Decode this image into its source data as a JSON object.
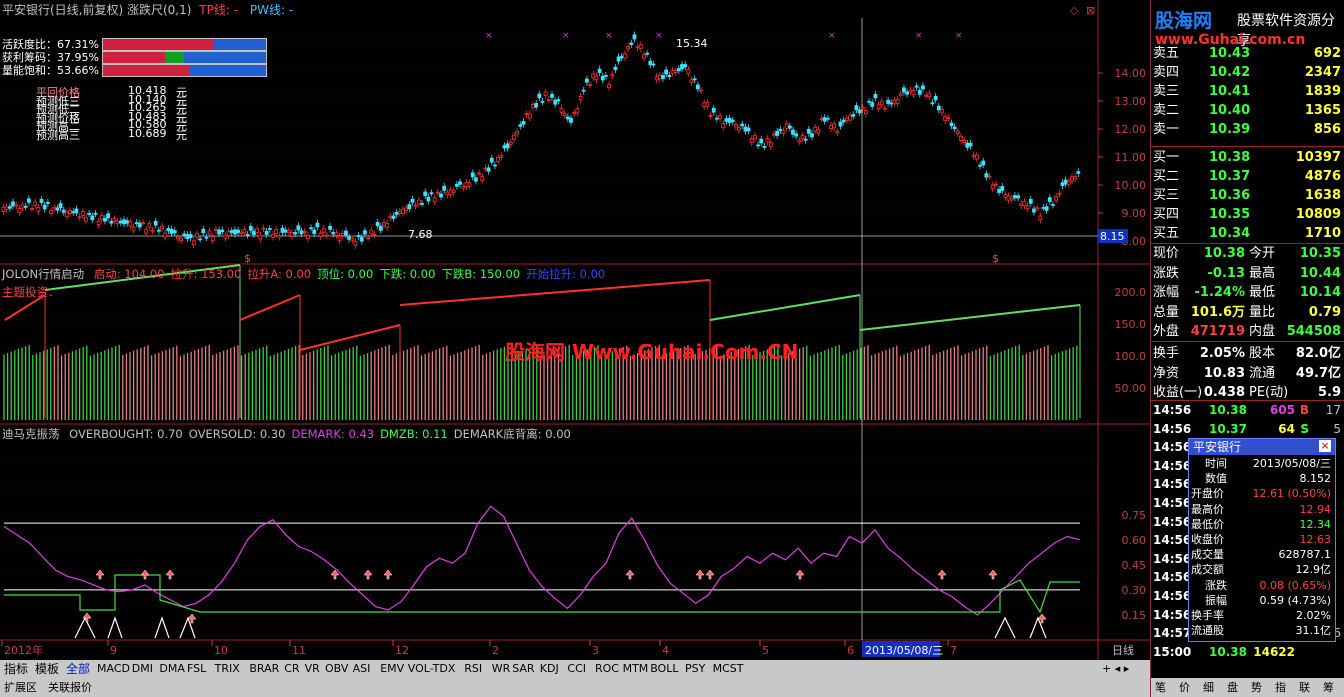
{
  "header": {
    "title": "平安银行(日线,前复权) 涨跌尺(0,1)",
    "tp_label": "TP线: -",
    "pw_label": "PW线: -"
  },
  "watermark_logo": "股海网",
  "watermark_sub": "股票软件资源分享",
  "watermark_url": "www.Guhai.com.cn",
  "watermark_center": "股海网 Www.Guhai.Com.CN",
  "gauges": [
    {
      "label": "活跃度比：67.31%",
      "red": 0.6731,
      "green": 0
    },
    {
      "label": "获利筹码：37.95%",
      "red": 0.38,
      "green": 0.12
    },
    {
      "label": "量能饱和：53.66%",
      "red": 0.5366,
      "green": 0
    }
  ],
  "predictions": [
    {
      "label": "平回价格",
      "value": "10.418",
      "unit": "元"
    },
    {
      "label": "预测低三",
      "value": "10.140",
      "unit": "元"
    },
    {
      "label": "预测低二",
      "value": "10.265",
      "unit": "元"
    },
    {
      "label": "预测价格",
      "value": "10.483",
      "unit": "元"
    },
    {
      "label": "预测高二",
      "value": "10.580",
      "unit": "元"
    },
    {
      "label": "预测高三",
      "value": "10.689",
      "unit": "元"
    }
  ],
  "price_axis": [
    "14.00",
    "13.00",
    "12.00",
    "11.00",
    "10.00",
    "9.00",
    "8.00"
  ],
  "price_marks": {
    "high": "15.34",
    "low": "7.68",
    "cursor": "8.15"
  },
  "indicator1": {
    "name": "JOLON行情启动",
    "params": [
      {
        "label": "启动: 104.00",
        "color": "#ff4040"
      },
      {
        "label": "拉升: 153.00",
        "color": "#ff4040"
      },
      {
        "label": "拉升A: 0.00",
        "color": "#ff4040"
      },
      {
        "label": "顶位: 0.00",
        "color": "#40ff40"
      },
      {
        "label": "下跌: 0.00",
        "color": "#40ff40"
      },
      {
        "label": "下跌B: 150.00",
        "color": "#40ff40"
      },
      {
        "label": "开始拉升: 0.00",
        "color": "#4040ff"
      }
    ],
    "subtitle": "主题投资：",
    "axis": [
      "200.0",
      "150.0",
      "100.0",
      "50.00"
    ]
  },
  "indicator2": {
    "name": "迪马克振荡",
    "params": [
      {
        "label": "OVERBOUGHT: 0.70",
        "color": "#c0c0c0"
      },
      {
        "label": "OVERSOLD: 0.30",
        "color": "#c0c0c0"
      },
      {
        "label": "DEMARK: 0.43",
        "color": "#e040e0"
      },
      {
        "label": "DMZB: 0.11",
        "color": "#40ff40"
      },
      {
        "label": "DEMARK底背离: 0.00",
        "color": "#c0c0c0"
      }
    ],
    "axis": [
      "0.75",
      "0.60",
      "0.45",
      "0.30",
      "0.15"
    ]
  },
  "date_axis": [
    "2012年",
    "9",
    "10",
    "11",
    "12",
    "2",
    "3",
    "4",
    "5",
    "6",
    "7"
  ],
  "date_cursor": "2013/05/08/三",
  "period_label": "日线",
  "tabs": [
    "指标",
    "模板",
    "全部",
    "MACD",
    "DMI",
    "DMA",
    "FSL",
    "TRIX",
    "BRAR",
    "CR",
    "VR",
    "OBV",
    "ASI",
    "EMV",
    "VOL-TDX",
    "RSI",
    "WR",
    "SAR",
    "KDJ",
    "CCI",
    "ROC",
    "MTM",
    "BOLL",
    "PSY",
    "MCST"
  ],
  "bottom_tabs": [
    "扩展区",
    "关联报价"
  ],
  "orderbook": {
    "asks": [
      {
        "label": "卖五",
        "price": "10.43",
        "vol": "692"
      },
      {
        "label": "卖四",
        "price": "10.42",
        "vol": "2347"
      },
      {
        "label": "卖三",
        "price": "10.41",
        "vol": "1839"
      },
      {
        "label": "卖二",
        "price": "10.40",
        "vol": "1365"
      },
      {
        "label": "卖一",
        "price": "10.39",
        "vol": "856"
      }
    ],
    "bids": [
      {
        "label": "买一",
        "price": "10.38",
        "vol": "10397"
      },
      {
        "label": "买二",
        "price": "10.37",
        "vol": "4876"
      },
      {
        "label": "买三",
        "price": "10.36",
        "vol": "1638"
      },
      {
        "label": "买四",
        "price": "10.35",
        "vol": "10809"
      },
      {
        "label": "买五",
        "price": "10.34",
        "vol": "1710"
      }
    ]
  },
  "quote": [
    {
      "l1": "现价",
      "v1": "10.38",
      "c1": "#40ff40",
      "l2": "今开",
      "v2": "10.35",
      "c2": "#40ff40"
    },
    {
      "l1": "涨跌",
      "v1": "-0.13",
      "c1": "#40ff40",
      "l2": "最高",
      "v2": "10.44",
      "c2": "#40ff40"
    },
    {
      "l1": "涨幅",
      "v1": "-1.24%",
      "c1": "#40ff40",
      "l2": "最低",
      "v2": "10.14",
      "c2": "#40ff40"
    },
    {
      "l1": "总量",
      "v1": "101.6万",
      "c1": "#ffff40",
      "l2": "量比",
      "v2": "0.79",
      "c2": "#ffff40"
    },
    {
      "l1": "外盘",
      "v1": "471719",
      "c1": "#ff4040",
      "l2": "内盘",
      "v2": "544508",
      "c2": "#40ff40"
    },
    {
      "l1": "换手",
      "v1": "2.05%",
      "c1": "#ffffff",
      "l2": "股本",
      "v2": "82.0亿",
      "c2": "#ffffff"
    },
    {
      "l1": "净资",
      "v1": "10.83",
      "c1": "#ffffff",
      "l2": "流通",
      "v2": "49.7亿",
      "c2": "#ffffff"
    },
    {
      "l1": "收益(一)",
      "v1": "0.438",
      "c1": "#ffffff",
      "l2": "PE(动)",
      "v2": "5.9",
      "c2": "#ffffff"
    }
  ],
  "ticks": [
    {
      "t": "14:56",
      "p": "10.38",
      "v": "605",
      "d": "B",
      "n": "17"
    },
    {
      "t": "14:56",
      "p": "10.37",
      "v": "64",
      "d": "S",
      "n": "5"
    },
    {
      "t": "14:56",
      "p": "",
      "v": "",
      "d": "",
      "n": ""
    },
    {
      "t": "14:56",
      "p": "",
      "v": "",
      "d": "",
      "n": ""
    },
    {
      "t": "14:56",
      "p": "",
      "v": "",
      "d": "",
      "n": ""
    },
    {
      "t": "14:56",
      "p": "",
      "v": "",
      "d": "",
      "n": ""
    },
    {
      "t": "14:56",
      "p": "",
      "v": "",
      "d": "",
      "n": ""
    },
    {
      "t": "14:56",
      "p": "",
      "v": "",
      "d": "",
      "n": ""
    },
    {
      "t": "14:56",
      "p": "",
      "v": "",
      "d": "",
      "n": ""
    },
    {
      "t": "14:56",
      "p": "",
      "v": "",
      "d": "",
      "n": ""
    },
    {
      "t": "14:56",
      "p": "",
      "v": "",
      "d": "",
      "n": ""
    },
    {
      "t": "14:56",
      "p": "",
      "v": "",
      "d": "",
      "n": ""
    },
    {
      "t": "14:57",
      "p": "10.37",
      "v": "3953",
      "d": "S",
      "n": "116"
    },
    {
      "t": "15:00",
      "p": "10.38",
      "v": "14622",
      "d": "",
      "n": ""
    }
  ],
  "popup": {
    "title": "平安银行",
    "rows": [
      {
        "l": "时间",
        "v": "2013/05/08/三",
        "c": "#ffffff"
      },
      {
        "l": "数值",
        "v": "8.152",
        "c": "#ffffff"
      },
      {
        "l": "开盘价",
        "v": "12.61 (0.50%)",
        "c": "#ff4040"
      },
      {
        "l": "最高价",
        "v": "12.94",
        "c": "#ff4040"
      },
      {
        "l": "最低价",
        "v": "12.34",
        "c": "#40ff40"
      },
      {
        "l": "收盘价",
        "v": "12.63",
        "c": "#ff4040"
      },
      {
        "l": "成交量",
        "v": "628787.1",
        "c": "#ffffff"
      },
      {
        "l": "成交额",
        "v": "12.9亿",
        "c": "#ffffff"
      },
      {
        "l": "涨跌",
        "v": "0.08 (0.65%)",
        "c": "#ff4040"
      },
      {
        "l": "振幅",
        "v": "0.59 (4.73%)",
        "c": "#ffffff"
      },
      {
        "l": "换手率",
        "v": "2.02%",
        "c": "#ffffff"
      },
      {
        "l": "流通股",
        "v": "31.1亿",
        "c": "#ffffff"
      }
    ]
  },
  "right_tabs": [
    "笔",
    "价",
    "细",
    "盘",
    "势",
    "指",
    "联",
    "筹"
  ],
  "chart_data": {
    "type": "candlestick",
    "closes": [
      9.2,
      9.25,
      9.3,
      9.2,
      9.1,
      9.0,
      8.9,
      8.8,
      8.7,
      8.6,
      8.55,
      8.5,
      8.4,
      8.2,
      8.1,
      8.2,
      8.3,
      8.25,
      8.3,
      8.3,
      8.35,
      8.3,
      8.35,
      8.3,
      8.4,
      8.3,
      8.2,
      8.0,
      8.2,
      8.5,
      8.9,
      9.2,
      9.4,
      9.6,
      9.7,
      9.9,
      10.1,
      10.4,
      10.8,
      11.4,
      12.1,
      12.8,
      13.2,
      12.9,
      12.2,
      13.4,
      14.0,
      13.7,
      14.6,
      15.2,
      14.6,
      13.8,
      14.0,
      14.2,
      13.5,
      12.6,
      12.3,
      12.2,
      11.9,
      11.4,
      11.7,
      12.1,
      11.6,
      11.8,
      12.4,
      12.0,
      12.5,
      12.7,
      13.0,
      12.8,
      13.2,
      13.4,
      13.3,
      12.8,
      12.2,
      11.6,
      11.0,
      10.2,
      9.7,
      9.5,
      9.3,
      9.0,
      9.4,
      10.1,
      10.4
    ],
    "jolon_levels": [
      "100",
      "150",
      "200"
    ],
    "demark": [
      0.68,
      0.63,
      0.58,
      0.5,
      0.42,
      0.38,
      0.36,
      0.33,
      0.3,
      0.29,
      0.3,
      0.33,
      0.28,
      0.24,
      0.2,
      0.22,
      0.27,
      0.35,
      0.46,
      0.6,
      0.68,
      0.72,
      0.63,
      0.56,
      0.53,
      0.48,
      0.42,
      0.34,
      0.27,
      0.2,
      0.18,
      0.23,
      0.33,
      0.44,
      0.49,
      0.46,
      0.52,
      0.7,
      0.8,
      0.74,
      0.58,
      0.42,
      0.32,
      0.25,
      0.19,
      0.27,
      0.38,
      0.46,
      0.64,
      0.73,
      0.6,
      0.45,
      0.34,
      0.28,
      0.22,
      0.27,
      0.38,
      0.43,
      0.5,
      0.46,
      0.52,
      0.48,
      0.55,
      0.46,
      0.52,
      0.5,
      0.62,
      0.58,
      0.66,
      0.55,
      0.49,
      0.42,
      0.36,
      0.3,
      0.26,
      0.2,
      0.15,
      0.22,
      0.3,
      0.38,
      0.46,
      0.52,
      0.58,
      0.62,
      0.6
    ]
  }
}
